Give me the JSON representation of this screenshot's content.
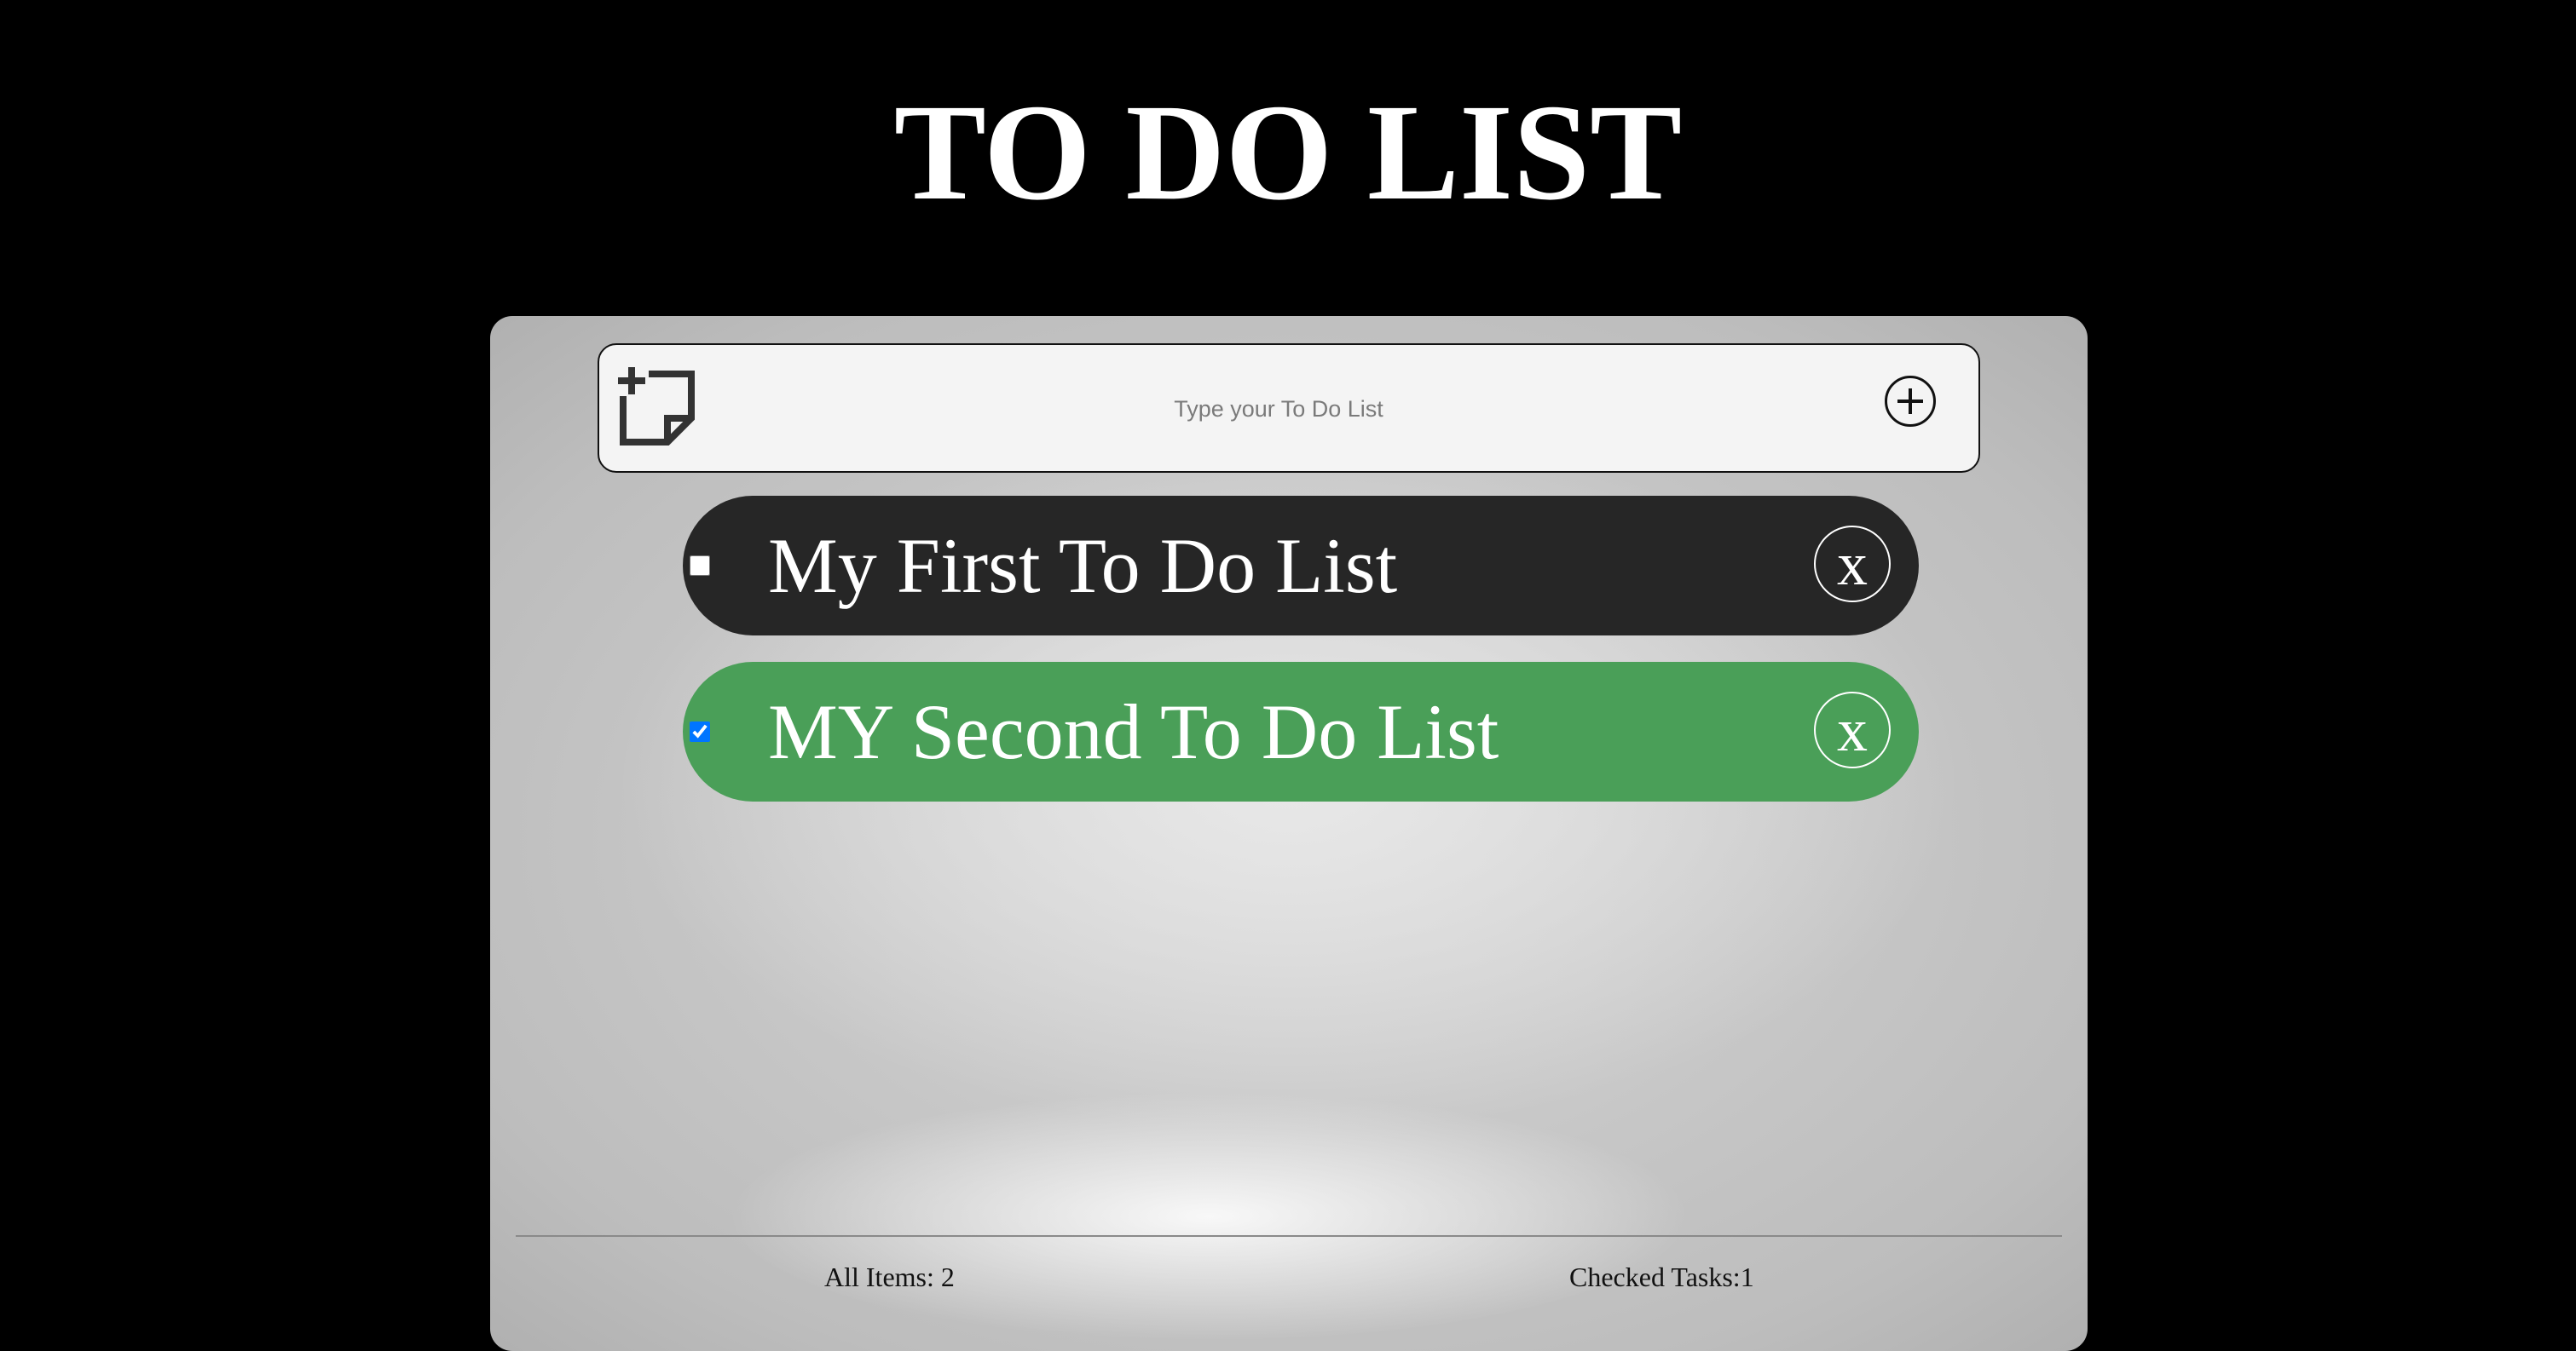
{
  "header": {
    "title": "TO DO LIST"
  },
  "input": {
    "placeholder": "Type your To Do List",
    "value": "",
    "icon": "add-note-icon",
    "add_icon": "plus-circle-icon"
  },
  "todos": [
    {
      "label": "My First To Do List",
      "checked": false,
      "color": "#262626",
      "delete_label": "x"
    },
    {
      "label": "MY Second To Do List",
      "checked": true,
      "color": "#4a9f58",
      "delete_label": "x"
    }
  ],
  "footer": {
    "all_items": "All Items: 2",
    "checked_tasks": "Checked Tasks:1"
  },
  "colors": {
    "background": "#000000",
    "checked_item": "#4a9f58",
    "unchecked_item": "#262626",
    "input_bg": "#f4f4f4"
  }
}
